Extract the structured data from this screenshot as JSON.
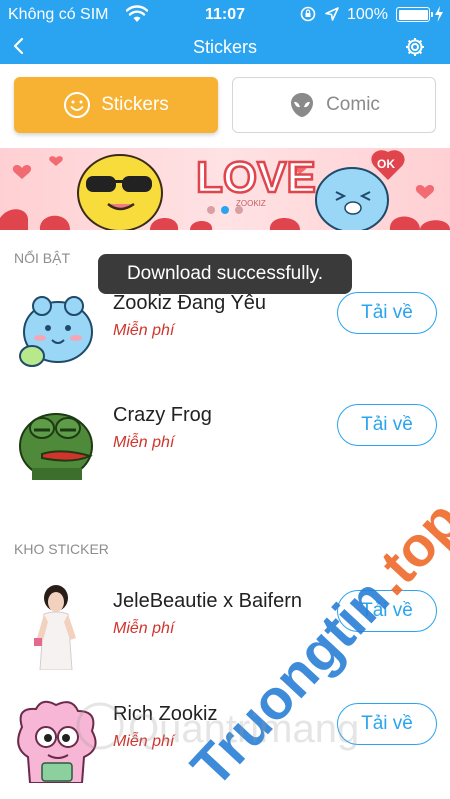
{
  "status_bar": {
    "carrier": "Không có SIM",
    "time": "11:07",
    "battery_percent": "100%"
  },
  "nav": {
    "title": "Stickers"
  },
  "tabs": [
    {
      "label": "Stickers",
      "active": true,
      "icon": "smiley-icon"
    },
    {
      "label": "Comic",
      "active": false,
      "icon": "alien-icon"
    }
  ],
  "banner": {
    "headline": "LOVE",
    "brand": "ZOOKIZ",
    "badge": "OK",
    "page_index": 1,
    "page_count": 3
  },
  "toast": {
    "message": "Download successfully."
  },
  "featured": {
    "label": "NỔI BẬT",
    "items": [
      {
        "name": "Zookiz Đang Yêu",
        "price": "Miễn phí",
        "action": "Tải về"
      },
      {
        "name": "Crazy Frog",
        "price": "Miễn phí",
        "action": "Tải về"
      }
    ]
  },
  "store": {
    "label": "KHO STICKER",
    "items": [
      {
        "name": "JeleBeautie x Baifern",
        "price": "Miễn phí",
        "action": "Tải về"
      },
      {
        "name": "Rich Zookiz",
        "price": "Miễn phí",
        "action": "Tải về"
      }
    ]
  },
  "colors": {
    "accent": "#2aa4f0",
    "tab_active": "#f7b233",
    "price": "#d0342c"
  }
}
